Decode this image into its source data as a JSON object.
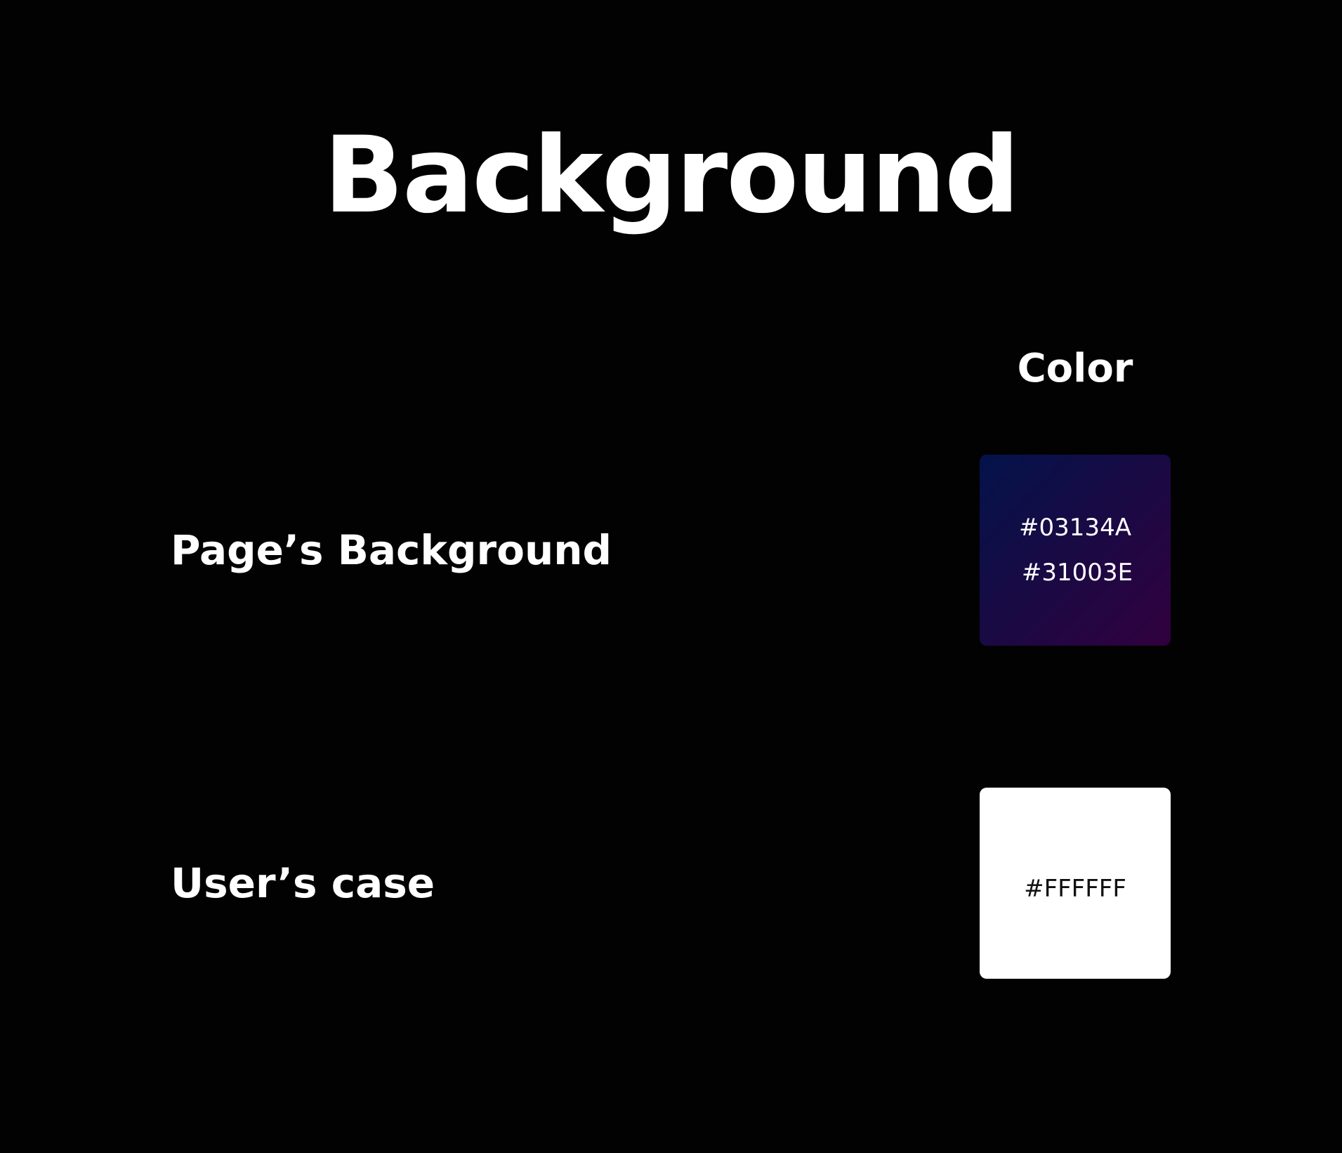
{
  "page": {
    "title": "Background",
    "column_header": "Color"
  },
  "rows": [
    {
      "label": "Page’s Background",
      "swatch": {
        "type": "gradient",
        "codes": [
          "#03134A",
          "#31003E"
        ],
        "colors": [
          "#03134A",
          "#31003E"
        ]
      }
    },
    {
      "label": "User’s case",
      "swatch": {
        "type": "solid",
        "codes": [
          "#FFFFFF"
        ],
        "colors": [
          "#FFFFFF"
        ]
      }
    }
  ],
  "theme": {
    "background": "#020202",
    "text": "#FFFFFF"
  }
}
